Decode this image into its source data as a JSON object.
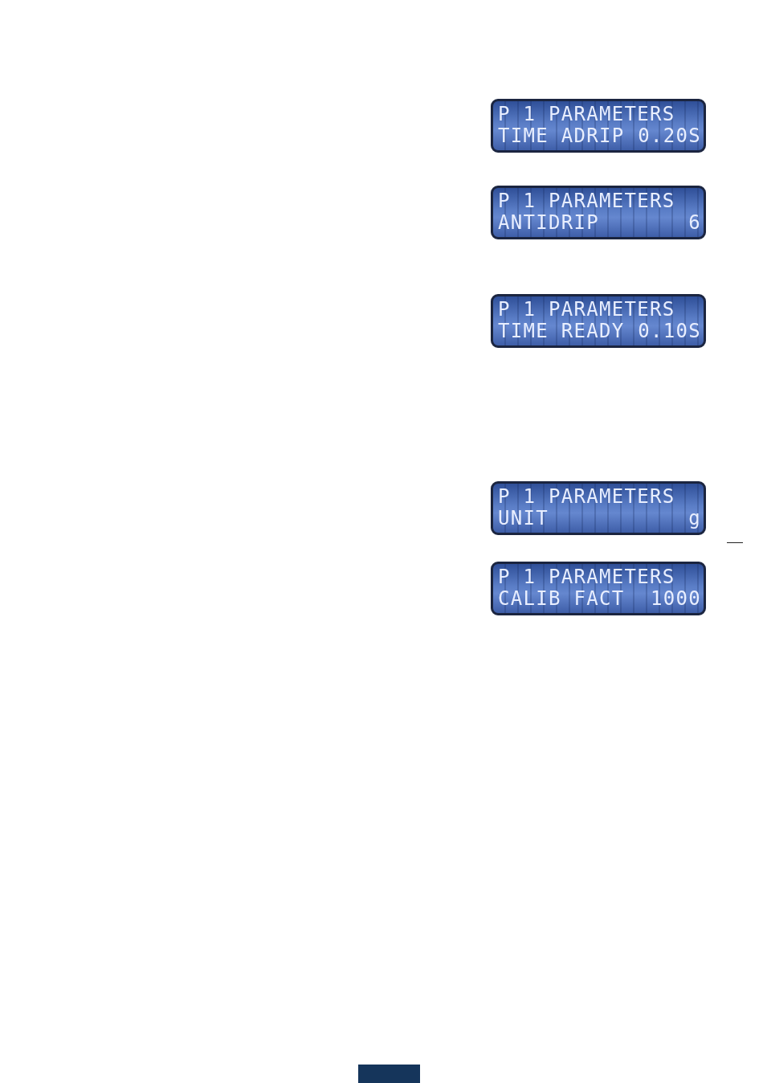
{
  "displays": [
    {
      "title": "P 1 PARAMETERS",
      "label": "TIME ADRIP",
      "value": "0.20S"
    },
    {
      "title": "P 1 PARAMETERS",
      "label": "ANTIDRIP",
      "value": "6"
    },
    {
      "title": "P 1 PARAMETERS",
      "label": "TIME READY",
      "value": "0.10S"
    },
    {
      "title": "P 1 PARAMETERS",
      "label": "UNIT",
      "value": "g"
    },
    {
      "title": "P 1 PARAMETERS",
      "label": "CALIB FACT",
      "value": "1000"
    }
  ]
}
